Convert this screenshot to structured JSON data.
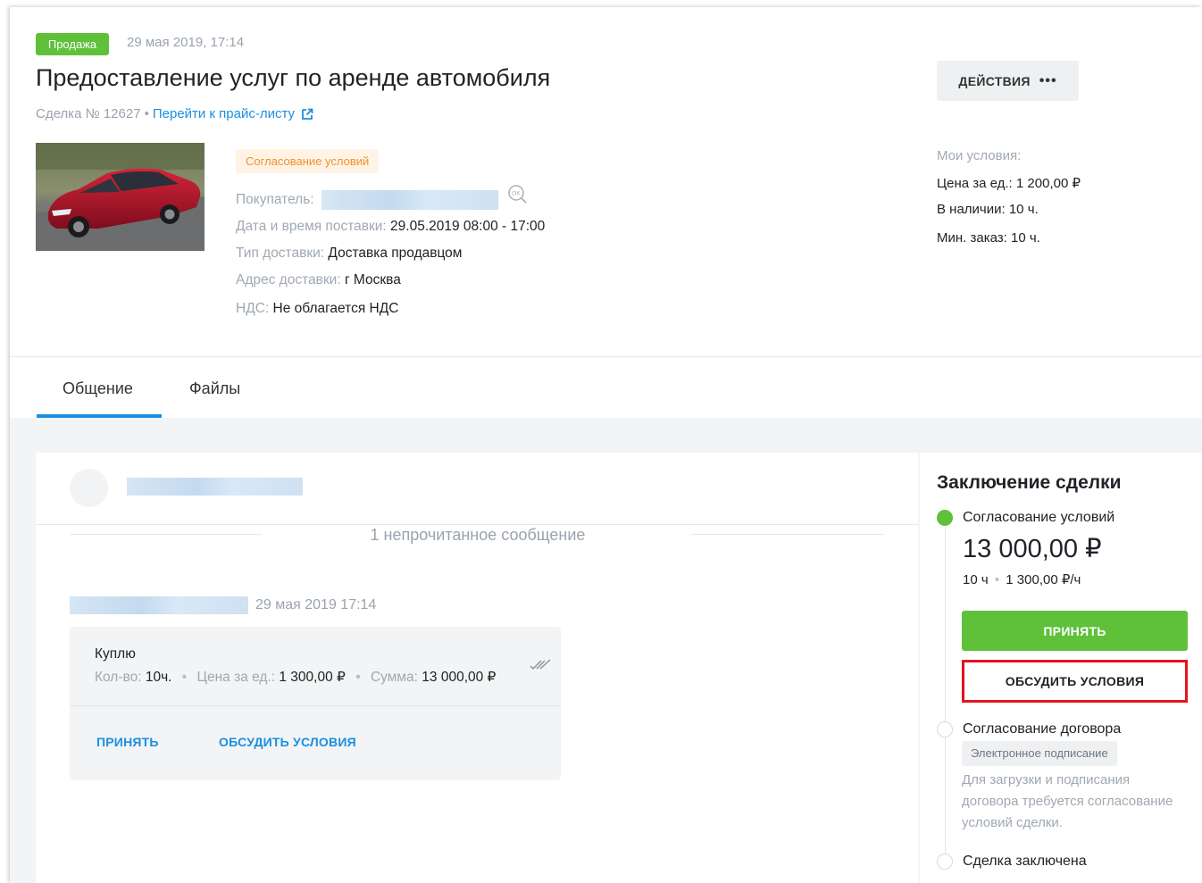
{
  "header": {
    "badge": "Продажа",
    "date": "29 мая 2019, 17:14",
    "title": "Предоставление услуг по аренде автомобиля",
    "deal_number": "Сделка № 12627",
    "separator": "•",
    "price_list_link": "Перейти к прайс-листу",
    "actions_label": "ДЕЙСТВИЯ",
    "actions_more": "•••"
  },
  "deal_info": {
    "status": "Согласование условий",
    "buyer_label": "Покупатель:",
    "delivery_time_label": "Дата и время поставки:",
    "delivery_time_value": "29.05.2019 08:00 - 17:00",
    "delivery_type_label": "Тип доставки:",
    "delivery_type_value": "Доставка продавцом",
    "address_label": "Адрес доставки:",
    "address_value": "г Москва",
    "vat_label": "НДС:",
    "vat_value": "Не облагается НДС"
  },
  "my_terms": {
    "title": "Мои условия:",
    "unit_price_label": "Цена за ед.:",
    "unit_price_value": "1 200,00 ₽",
    "stock_label": "В наличии:",
    "stock_value": "10 ч.",
    "min_order_label": "Мин. заказ:",
    "min_order_value": "10 ч."
  },
  "tabs": [
    {
      "label": "Общение"
    },
    {
      "label": "Файлы"
    }
  ],
  "chat": {
    "unread_text": "1 непрочитанное сообщение",
    "message": {
      "time": "29 мая 2019 17:14",
      "text": "Куплю",
      "qty_label": "Кол-во:",
      "qty_value": "10ч.",
      "unit_price_label": "Цена за ед.:",
      "unit_price_value": "1 300,00 ₽",
      "sum_label": "Сумма:",
      "sum_value": "13 000,00 ₽",
      "accept_link": "ПРИНЯТЬ",
      "discuss_link": "ОБСУДИТЬ УСЛОВИЯ"
    }
  },
  "sidebar": {
    "title": "Заключение сделки",
    "steps": [
      {
        "label": "Согласование условий"
      },
      {
        "label": "Согласование договора"
      },
      {
        "label": "Сделка заключена"
      }
    ],
    "price": "13 000,00 ₽",
    "price_qty": "10 ч",
    "price_rate": "1 300,00 ₽/ч",
    "accept_button": "ПРИНЯТЬ",
    "discuss_button": "ОБСУДИТЬ УСЛОВИЯ",
    "esign_tag": "Электронное подписание",
    "contract_note": "Для загрузки и подписания договора требуется согласование условий сделки."
  },
  "colors": {
    "accent_green": "#5fc03a",
    "link_blue": "#1a8fe0",
    "highlight_red": "#e3141b",
    "status_orange": "#f0902a"
  },
  "icons": {
    "external_link": "external-link-icon",
    "ok": "ok-icon",
    "double_check": "double-check-icon"
  }
}
